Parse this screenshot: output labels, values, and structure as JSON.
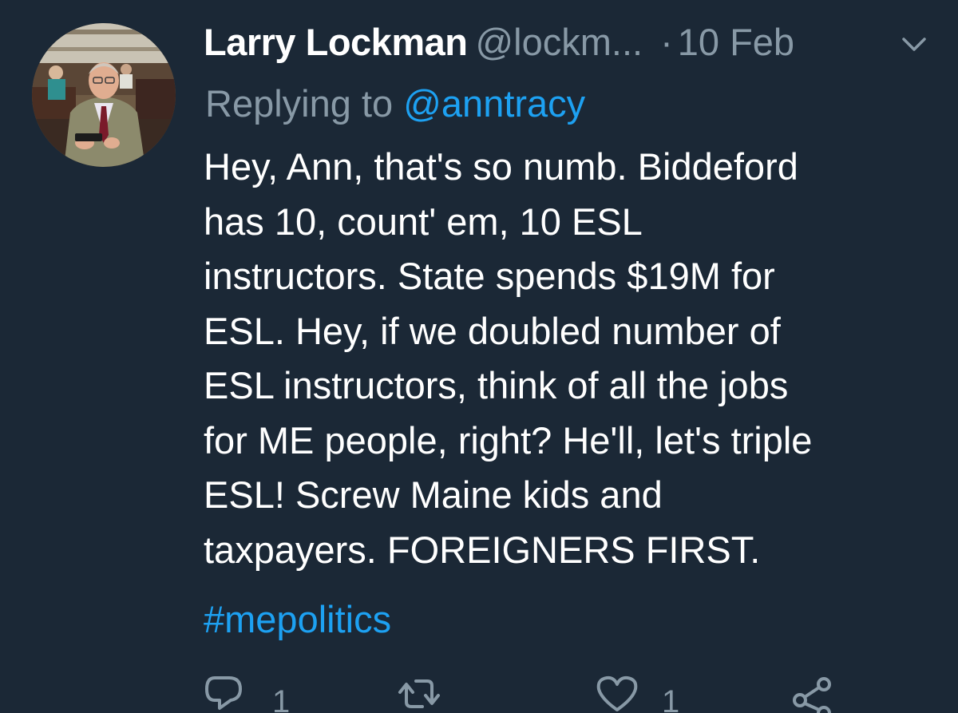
{
  "tweet": {
    "author_name": "Larry Lockman",
    "author_handle": "@lockm...",
    "separator": "·",
    "date": "10 Feb",
    "replying_prefix": "Replying to",
    "replying_handle": "@anntracy",
    "text": "Hey, Ann, that's so numb. Biddeford\nhas 10, count' em, 10 ESL\ninstructors. State spends $19M for\nESL. Hey, if we doubled number of\nESL instructors, think of all the jobs\nfor ME people, right? He'll, let's triple\nESL! Screw Maine kids and\ntaxpayers. FOREIGNERS FIRST.",
    "hashtag": "#mepolitics"
  },
  "actions": {
    "reply_count": "1",
    "retweet_count": "",
    "like_count": "1"
  },
  "icons": {
    "caret": "chevron-down-icon",
    "reply": "reply-icon",
    "retweet": "retweet-icon",
    "like": "heart-icon",
    "share": "share-icon"
  },
  "colors": {
    "background": "#1b2836",
    "text": "#ffffff",
    "muted": "#8899a6",
    "link": "#1da1f2"
  }
}
